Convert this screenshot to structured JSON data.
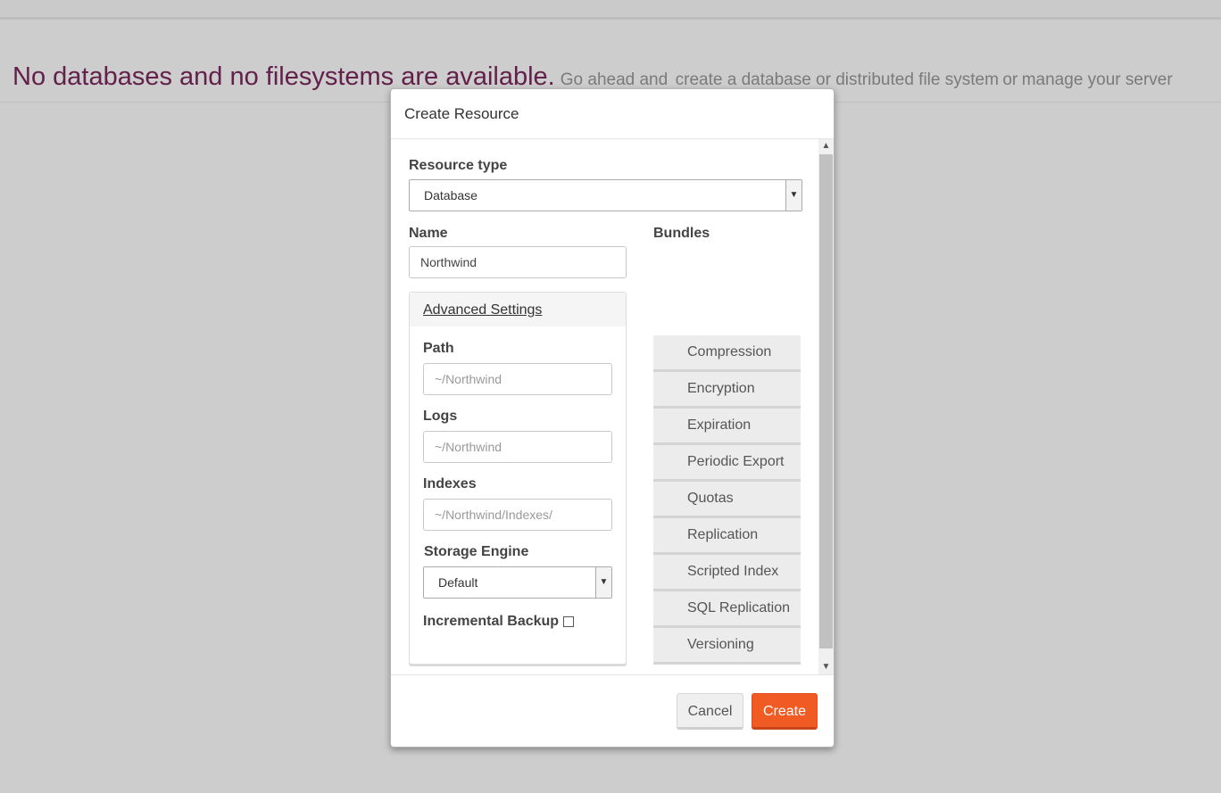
{
  "notice": {
    "headline": "No databases and no filesystems are available.",
    "lead": "Go ahead and",
    "create_link": "create a database or distributed file system",
    "or": "or",
    "manage_link": "manage your server"
  },
  "modal": {
    "title": "Create Resource",
    "resource_type": {
      "label": "Resource type",
      "value": "Database"
    },
    "name": {
      "label": "Name",
      "value": "Northwind"
    },
    "advanced": {
      "title": "Advanced Settings",
      "path": {
        "label": "Path",
        "placeholder": "~/Northwind"
      },
      "logs": {
        "label": "Logs",
        "placeholder": "~/Northwind"
      },
      "indexes": {
        "label": "Indexes",
        "placeholder": "~/Northwind/Indexes/"
      },
      "storage_engine": {
        "label": "Storage Engine",
        "value": "Default"
      },
      "incremental_backup": {
        "label": "Incremental Backup",
        "checked": false
      }
    },
    "bundles": {
      "label": "Bundles",
      "items": [
        "Compression",
        "Encryption",
        "Expiration",
        "Periodic Export",
        "Quotas",
        "Replication",
        "Scripted Index",
        "SQL Replication",
        "Versioning"
      ]
    },
    "buttons": {
      "cancel": "Cancel",
      "create": "Create"
    }
  },
  "icons": {
    "dropdown": "chevron-down-icon",
    "scroll_up": "scroll-up-arrow-icon",
    "scroll_down": "scroll-down-arrow-icon"
  },
  "colors": {
    "accent": "#f05a23",
    "link": "#8b1a2f",
    "headline": "#63204a"
  }
}
